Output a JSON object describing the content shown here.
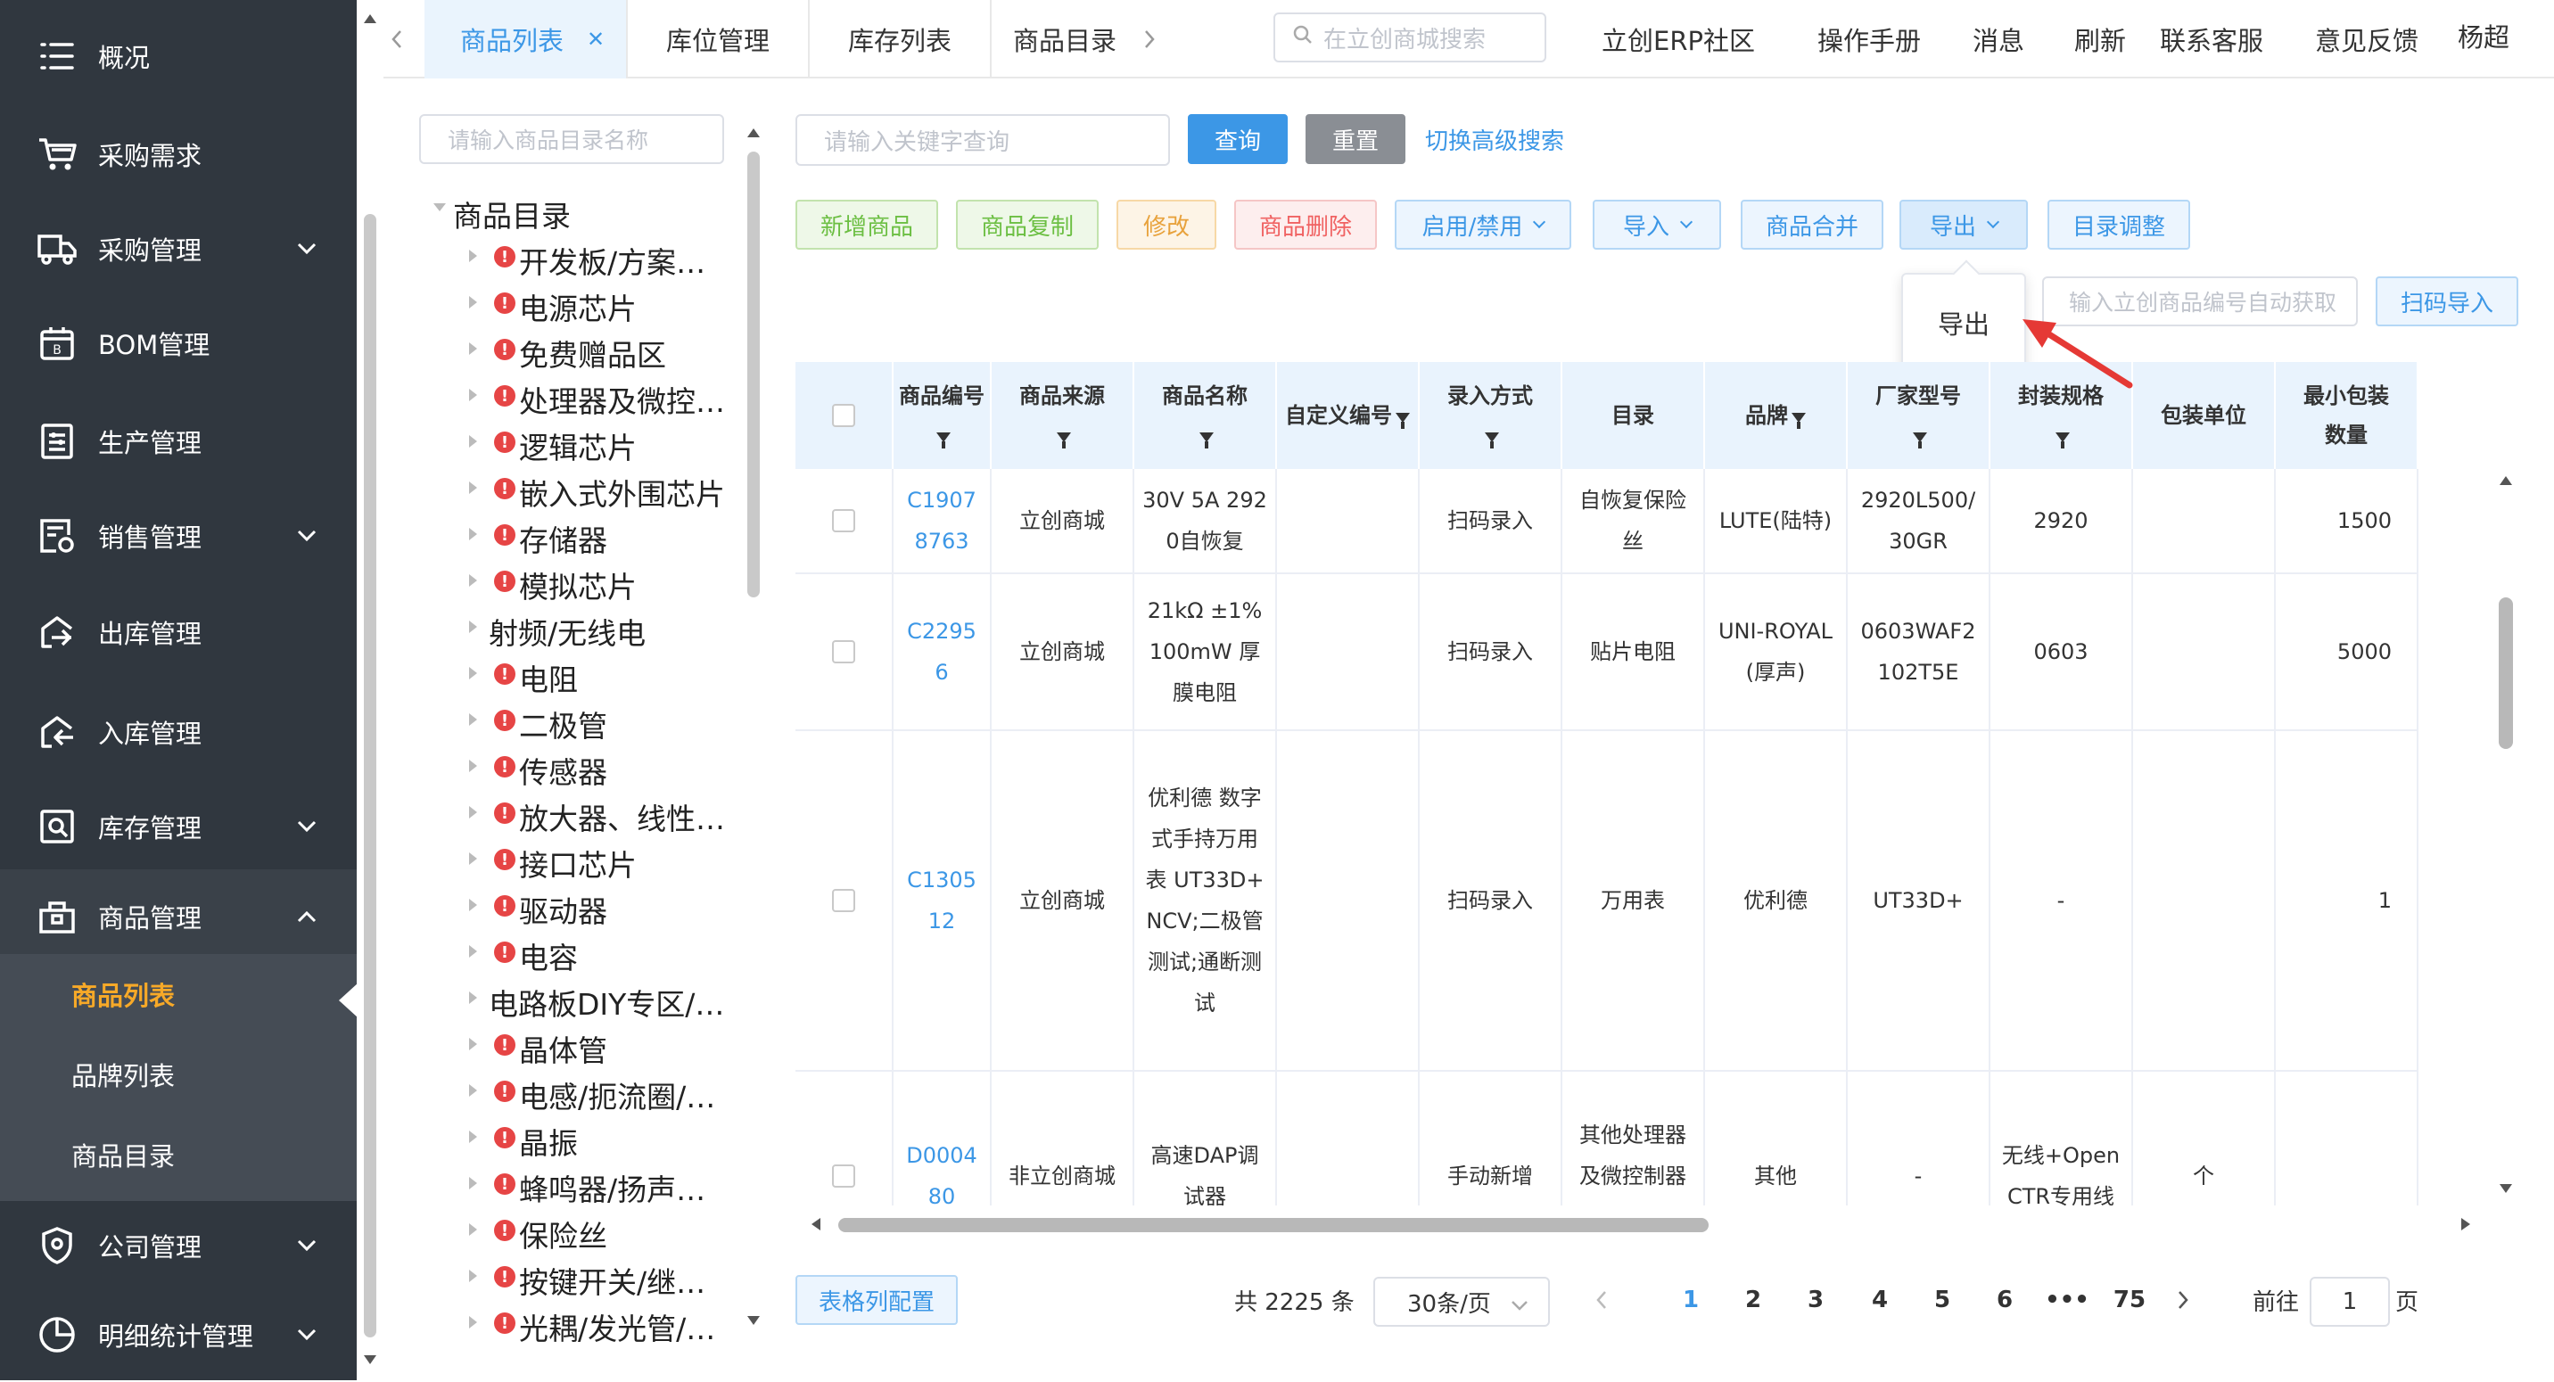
{
  "sidebar": {
    "items": [
      {
        "label": "概况",
        "icon": "menu-list-icon"
      },
      {
        "label": "采购需求",
        "icon": "cart-icon"
      },
      {
        "label": "采购管理",
        "icon": "truck-icon"
      },
      {
        "label": "BOM管理",
        "icon": "bom-icon"
      },
      {
        "label": "生产管理",
        "icon": "production-icon"
      },
      {
        "label": "销售管理",
        "icon": "sales-icon"
      },
      {
        "label": "出库管理",
        "icon": "outbound-icon"
      },
      {
        "label": "入库管理",
        "icon": "inbound-icon"
      },
      {
        "label": "库存管理",
        "icon": "inventory-icon"
      },
      {
        "label": "商品管理",
        "icon": "goods-icon"
      },
      {
        "label": "公司管理",
        "icon": "company-icon"
      },
      {
        "label": "明细统计管理",
        "icon": "stats-icon"
      }
    ],
    "submenu": [
      {
        "label": "商品列表",
        "active": true
      },
      {
        "label": "品牌列表",
        "active": false
      },
      {
        "label": "商品目录",
        "active": false
      }
    ]
  },
  "tabs": [
    {
      "label": "商品列表",
      "active": true
    },
    {
      "label": "库位管理"
    },
    {
      "label": "库存列表"
    },
    {
      "label": "商品目录"
    }
  ],
  "topnav": {
    "search_placeholder": "在立创商城搜索",
    "links": [
      "立创ERP社区",
      "操作手册",
      "消息",
      "刷新",
      "联系客服",
      "意见反馈",
      "杨超"
    ]
  },
  "tree": {
    "search_placeholder": "请输入商品目录名称",
    "root": "商品目录",
    "nodes": [
      {
        "label": "开发板/方案…",
        "warn": true
      },
      {
        "label": "电源芯片",
        "warn": true
      },
      {
        "label": "免费赠品区",
        "warn": true
      },
      {
        "label": "处理器及微控…",
        "warn": true
      },
      {
        "label": "逻辑芯片",
        "warn": true
      },
      {
        "label": "嵌入式外围芯片",
        "warn": true
      },
      {
        "label": "存储器",
        "warn": true
      },
      {
        "label": "模拟芯片",
        "warn": true
      },
      {
        "label": "射频/无线电",
        "warn": false
      },
      {
        "label": "电阻",
        "warn": true
      },
      {
        "label": "二极管",
        "warn": true
      },
      {
        "label": "传感器",
        "warn": true
      },
      {
        "label": "放大器、线性…",
        "warn": true
      },
      {
        "label": "接口芯片",
        "warn": true
      },
      {
        "label": "驱动器",
        "warn": true
      },
      {
        "label": "电容",
        "warn": true
      },
      {
        "label": "电路板DIY专区/…",
        "warn": false
      },
      {
        "label": "晶体管",
        "warn": true
      },
      {
        "label": "电感/扼流圈/…",
        "warn": true
      },
      {
        "label": "晶振",
        "warn": true
      },
      {
        "label": "蜂鸣器/扬声…",
        "warn": true
      },
      {
        "label": "保险丝",
        "warn": true
      },
      {
        "label": "按键开关/继…",
        "warn": true
      },
      {
        "label": "光耦/发光管/…",
        "warn": true
      }
    ],
    "warn_glyph": "!"
  },
  "toolbar": {
    "keyword_placeholder": "请输入关键字查询",
    "query": "查询",
    "reset": "重置",
    "advanced": "切换高级搜索",
    "add": "新增商品",
    "copy": "商品复制",
    "edit": "修改",
    "delete": "商品删除",
    "toggle": "启用/禁用",
    "import": "导入",
    "merge": "商品合并",
    "export": "导出",
    "catalog_adjust": "目录调整",
    "export_menu_item": "导出",
    "lc_placeholder": "输入立创商品编号自动获取",
    "scan_import": "扫码导入"
  },
  "table": {
    "headers": [
      "商品编号",
      "商品来源",
      "商品名称",
      "自定义编号",
      "录入方式",
      "目录",
      "品牌",
      "厂家型号",
      "封装规格",
      "包装单位",
      "最小包装数量"
    ],
    "rows": [
      {
        "code": "C19078763",
        "source": "立创商城",
        "name": "30V 5A 2920自恢复",
        "custom": "",
        "entry": "扫码录入",
        "catalog": "自恢复保险丝",
        "brand": "LUTE(陆特)",
        "model": "2920L500/30GR",
        "package": "2920",
        "unit": "",
        "min_qty": "1500"
      },
      {
        "code": "C22956",
        "source": "立创商城",
        "name": "21kΩ ±1% 100mW 厚膜电阻",
        "custom": "",
        "entry": "扫码录入",
        "catalog": "贴片电阻",
        "brand": "UNI-ROYAL(厚声)",
        "model": "0603WAF2102T5E",
        "package": "0603",
        "unit": "",
        "min_qty": "5000"
      },
      {
        "code": "C130512",
        "source": "立创商城",
        "name": "优利德 数字式手持万用表 UT33D+ NCV;二极管测试;通断测试",
        "custom": "",
        "entry": "扫码录入",
        "catalog": "万用表",
        "brand": "优利德",
        "model": "UT33D+",
        "package": "-",
        "unit": "",
        "min_qty": "1"
      },
      {
        "code": "D000480",
        "source": "非立创商城",
        "name": "高速DAP调试器",
        "custom": "",
        "entry": "手动新增",
        "catalog": "其他处理器及微控制器(MCU)",
        "brand": "其他",
        "model": "-",
        "package": "无线+OpenCTR专用线",
        "unit": "个",
        "min_qty": ""
      }
    ]
  },
  "footer": {
    "col_config": "表格列配置",
    "total": "共 2225 条",
    "page_size": "30条/页",
    "pages": [
      "1",
      "2",
      "3",
      "4",
      "5",
      "6",
      "•••",
      "75"
    ],
    "current_page": "1",
    "goto_label": "前往",
    "goto_value": "1",
    "goto_suffix": "页"
  },
  "colors": {
    "sidebar_bg": "#30373f",
    "submenu_bg": "#454c55",
    "accent": "#3c97e6",
    "active_sub": "#f7a928",
    "header_bg": "#e9f3fd",
    "annotation_arrow": "#e53935"
  }
}
